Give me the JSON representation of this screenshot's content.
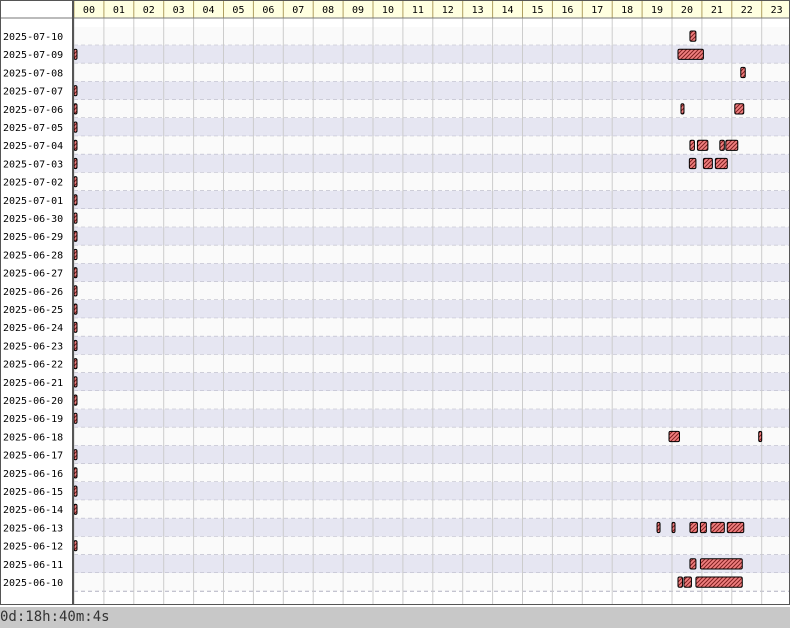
{
  "chart_data": {
    "type": "timeline",
    "title": "",
    "x_ticks": [
      "00",
      "01",
      "02",
      "03",
      "04",
      "05",
      "06",
      "07",
      "08",
      "09",
      "10",
      "11",
      "12",
      "13",
      "14",
      "15",
      "16",
      "17",
      "18",
      "19",
      "20",
      "21",
      "22",
      "23"
    ],
    "rows": [
      {
        "date": "2025-07-10",
        "intervals": [
          [
            20.6,
            20.8
          ]
        ]
      },
      {
        "date": "2025-07-09",
        "intervals": [
          [
            0.0,
            0.1
          ],
          [
            20.2,
            21.05
          ]
        ]
      },
      {
        "date": "2025-07-08",
        "intervals": [
          [
            22.3,
            22.45
          ]
        ]
      },
      {
        "date": "2025-07-07",
        "intervals": [
          [
            0.0,
            0.1
          ]
        ]
      },
      {
        "date": "2025-07-06",
        "intervals": [
          [
            0.0,
            0.1
          ],
          [
            20.3,
            20.38
          ],
          [
            22.1,
            22.4
          ]
        ]
      },
      {
        "date": "2025-07-05",
        "intervals": [
          [
            0.0,
            0.1
          ]
        ]
      },
      {
        "date": "2025-07-04",
        "intervals": [
          [
            0.0,
            0.1
          ],
          [
            20.6,
            20.75
          ],
          [
            20.85,
            21.2
          ],
          [
            21.6,
            21.75
          ],
          [
            21.8,
            22.2
          ]
        ]
      },
      {
        "date": "2025-07-03",
        "intervals": [
          [
            0.0,
            0.1
          ],
          [
            20.58,
            20.8
          ],
          [
            21.05,
            21.35
          ],
          [
            21.45,
            21.85
          ]
        ]
      },
      {
        "date": "2025-07-02",
        "intervals": [
          [
            0.0,
            0.1
          ]
        ]
      },
      {
        "date": "2025-07-01",
        "intervals": [
          [
            0.0,
            0.1
          ]
        ]
      },
      {
        "date": "2025-06-30",
        "intervals": [
          [
            0.0,
            0.1
          ]
        ]
      },
      {
        "date": "2025-06-29",
        "intervals": [
          [
            0.0,
            0.1
          ]
        ]
      },
      {
        "date": "2025-06-28",
        "intervals": [
          [
            0.0,
            0.1
          ]
        ]
      },
      {
        "date": "2025-06-27",
        "intervals": [
          [
            0.0,
            0.1
          ]
        ]
      },
      {
        "date": "2025-06-26",
        "intervals": [
          [
            0.0,
            0.1
          ]
        ]
      },
      {
        "date": "2025-06-25",
        "intervals": [
          [
            0.0,
            0.1
          ]
        ]
      },
      {
        "date": "2025-06-24",
        "intervals": [
          [
            0.0,
            0.1
          ]
        ]
      },
      {
        "date": "2025-06-23",
        "intervals": [
          [
            0.0,
            0.1
          ]
        ]
      },
      {
        "date": "2025-06-22",
        "intervals": [
          [
            0.0,
            0.1
          ]
        ]
      },
      {
        "date": "2025-06-21",
        "intervals": [
          [
            0.0,
            0.1
          ]
        ]
      },
      {
        "date": "2025-06-20",
        "intervals": [
          [
            0.0,
            0.1
          ]
        ]
      },
      {
        "date": "2025-06-19",
        "intervals": [
          [
            0.0,
            0.1
          ]
        ]
      },
      {
        "date": "2025-06-18",
        "intervals": [
          [
            19.9,
            20.25
          ],
          [
            22.9,
            22.98
          ]
        ]
      },
      {
        "date": "2025-06-17",
        "intervals": [
          [
            0.0,
            0.1
          ]
        ]
      },
      {
        "date": "2025-06-16",
        "intervals": [
          [
            0.0,
            0.1
          ]
        ]
      },
      {
        "date": "2025-06-15",
        "intervals": [
          [
            0.0,
            0.1
          ]
        ]
      },
      {
        "date": "2025-06-14",
        "intervals": [
          [
            0.0,
            0.1
          ]
        ]
      },
      {
        "date": "2025-06-13",
        "intervals": [
          [
            19.5,
            19.6
          ],
          [
            20.0,
            20.08
          ],
          [
            20.6,
            20.85
          ],
          [
            20.95,
            21.15
          ],
          [
            21.3,
            21.75
          ],
          [
            21.85,
            22.4
          ]
        ]
      },
      {
        "date": "2025-06-12",
        "intervals": [
          [
            0.0,
            0.1
          ]
        ]
      },
      {
        "date": "2025-06-11",
        "intervals": [
          [
            20.6,
            20.8
          ],
          [
            20.95,
            22.35
          ]
        ]
      },
      {
        "date": "2025-06-10",
        "intervals": [
          [
            20.2,
            20.35
          ],
          [
            20.4,
            20.65
          ],
          [
            20.8,
            22.35
          ]
        ]
      }
    ],
    "total_label": "0d:18h:40m:4s",
    "colors": {
      "bar_fill": "#f08080",
      "bar_hatch": "#802020",
      "bar_stroke": "#000000",
      "row_alt": "#e6e6f2",
      "row_plain": "#fafafa",
      "header_bg": "#ffffe0",
      "grid_line": "#cccccc",
      "dash_line": "#b0b0c0",
      "footer_bg": "#c8c8c8",
      "frame": "#555555"
    }
  }
}
